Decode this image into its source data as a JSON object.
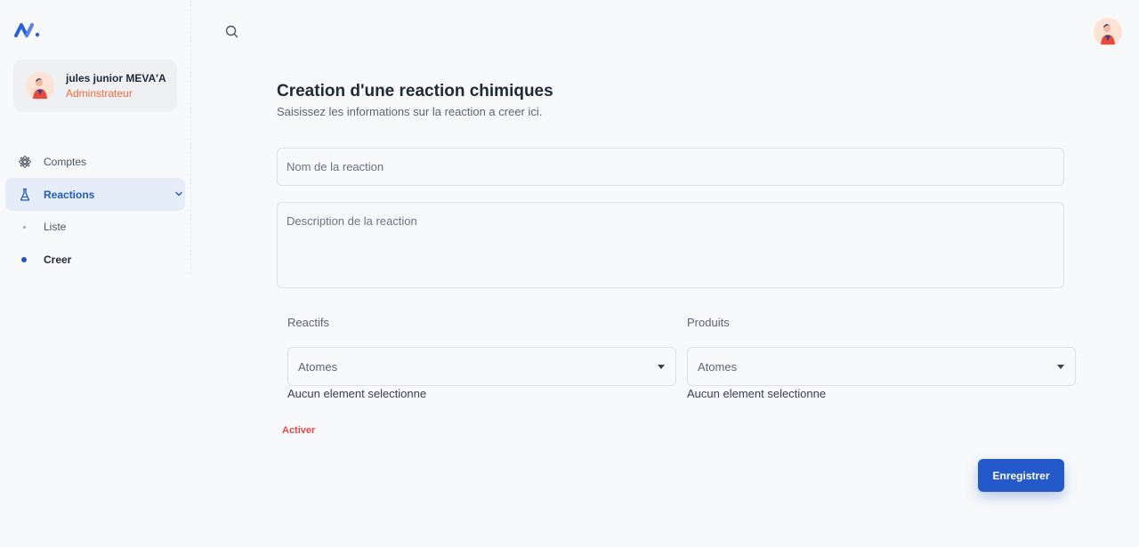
{
  "brand": {
    "logo_icon": "logo-icon",
    "accent": "#2359c8"
  },
  "user": {
    "name": "jules junior MEVA'A",
    "role": "Adminstrateur"
  },
  "sidebar": {
    "items": [
      {
        "label": "Comptes",
        "icon": "settings-flower-icon"
      },
      {
        "label": "Reactions",
        "icon": "flask-icon",
        "expanded": true
      }
    ],
    "sub_items": [
      {
        "label": "Liste"
      },
      {
        "label": "Creer",
        "current": true
      }
    ]
  },
  "header": {
    "search_icon": "search-icon"
  },
  "form": {
    "title": "Creation d'une reaction chimiques",
    "subtitle": "Saisissez les informations sur la reaction a creer ici.",
    "name_placeholder": "Nom de la reaction",
    "description_placeholder": "Description de la reaction",
    "reactants": {
      "label": "Reactifs",
      "select_value": "Atomes",
      "empty_text": "Aucun element selectionne"
    },
    "products": {
      "label": "Produits",
      "select_value": "Atomes",
      "empty_text": "Aucun element selectionne"
    },
    "activate_label": "Activer",
    "save_label": "Enregistrer"
  },
  "colors": {
    "danger": "#ef4444",
    "role": "#f06c3a",
    "active_bg": "#e5edf8"
  }
}
